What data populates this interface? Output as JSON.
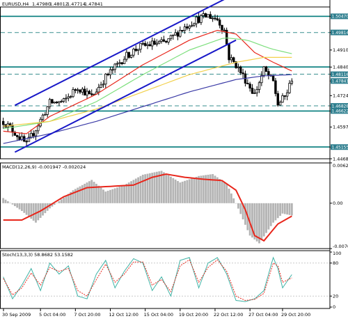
{
  "colors": {
    "background": "#ffffff",
    "grid_line": "#000000",
    "horizontal_level": "#007a7a",
    "dashed_level": "#3a8f8f",
    "trend_channel": "#1818c8",
    "ma_red": "#e8261b",
    "ma_green": "#7ddf7d",
    "ma_yellow": "#f2d04a",
    "ma_blue": "#3a3aa6",
    "macd_histogram": "#b4b4b4",
    "macd_signal": "#e8261b",
    "stoch_main": "#3fb3a6",
    "stoch_signal": "#e8261b",
    "price_tag": "#2f7f8f",
    "candle": "#000000"
  },
  "chart_data": [
    {
      "type": "candlestick",
      "panel": "price",
      "title": "EURUSD,H4",
      "header_values": [
        "1.47980",
        "1.48012",
        "1.47714",
        "1.47841"
      ],
      "ylim": [
        1.4468,
        1.5085
      ],
      "yticks": [
        "1.50470",
        "1.49814",
        "1.49100",
        "1.48407",
        "1.48116",
        "1.47841",
        "1.47245",
        "1.46828",
        "1.46622",
        "1.45970",
        "1.45155",
        "1.44680"
      ],
      "xticks": [
        "30 Sep 2009",
        "5 Oct 04:00",
        "7 Oct 20:00",
        "12 Oct 12:00",
        "15 Oct 04:00",
        "19 Oct 20:00",
        "22 Oct 12:00",
        "27 Oct 04:00",
        "29 Oct 20:00"
      ],
      "candles": {
        "count": 125,
        "start": 1.462,
        "end": 1.4784,
        "path": [
          [
            0,
            1.462
          ],
          [
            6,
            1.4565
          ],
          [
            10,
            1.4525
          ],
          [
            14,
            1.459
          ],
          [
            20,
            1.4695
          ],
          [
            26,
            1.47
          ],
          [
            32,
            1.476
          ],
          [
            38,
            1.472
          ],
          [
            44,
            1.48
          ],
          [
            52,
            1.488
          ],
          [
            58,
            1.492
          ],
          [
            64,
            1.4935
          ],
          [
            70,
            1.494
          ],
          [
            76,
            1.499
          ],
          [
            82,
            1.503
          ],
          [
            88,
            1.505
          ],
          [
            92,
            1.5035
          ],
          [
            95,
            1.499
          ],
          [
            97,
            1.488
          ],
          [
            100,
            1.485
          ],
          [
            104,
            1.479
          ],
          [
            108,
            1.473
          ],
          [
            112,
            1.483
          ],
          [
            116,
            1.478
          ],
          [
            118,
            1.469
          ],
          [
            121,
            1.472
          ],
          [
            124,
            1.4784
          ]
        ]
      },
      "solid_levels": [
        1.5047,
        1.4841,
        1.4662,
        1.4516
      ],
      "dashed_levels": [
        1.4981,
        1.4812,
        1.4683
      ],
      "trend_channel": {
        "lower": [
          [
            5,
            1.4495
          ],
          [
            100,
            1.495
          ]
        ],
        "upper": [
          [
            5,
            1.4685
          ],
          [
            100,
            1.514
          ]
        ]
      },
      "series": [
        {
          "color": "red",
          "values": [
            [
              0,
              1.458
            ],
            [
              10,
              1.457
            ],
            [
              20,
              1.464
            ],
            [
              40,
              1.473
            ],
            [
              60,
              1.485
            ],
            [
              80,
              1.495
            ],
            [
              92,
              1.499
            ],
            [
              100,
              1.4975
            ],
            [
              108,
              1.49
            ],
            [
              116,
              1.486
            ],
            [
              124,
              1.4825
            ]
          ]
        },
        {
          "color": "green",
          "values": [
            [
              0,
              1.459
            ],
            [
              20,
              1.462
            ],
            [
              40,
              1.47
            ],
            [
              60,
              1.481
            ],
            [
              80,
              1.491
            ],
            [
              95,
              1.496
            ],
            [
              105,
              1.495
            ],
            [
              115,
              1.4915
            ],
            [
              124,
              1.4895
            ]
          ]
        },
        {
          "color": "yellow",
          "values": [
            [
              0,
              1.46
            ],
            [
              20,
              1.462
            ],
            [
              40,
              1.467
            ],
            [
              60,
              1.474
            ],
            [
              80,
              1.481
            ],
            [
              100,
              1.486
            ],
            [
              112,
              1.488
            ],
            [
              124,
              1.488
            ]
          ]
        },
        {
          "color": "blue",
          "values": [
            [
              0,
              1.453
            ],
            [
              20,
              1.457
            ],
            [
              40,
              1.462
            ],
            [
              60,
              1.468
            ],
            [
              80,
              1.474
            ],
            [
              100,
              1.479
            ],
            [
              112,
              1.4805
            ],
            [
              124,
              1.481
            ]
          ]
        }
      ]
    },
    {
      "type": "bar",
      "panel": "macd",
      "title": "MACD(12,26,9) -0.001947 -0.002024",
      "ylim": [
        -0.00701,
        0.00622
      ],
      "yticks": [
        "0.006227",
        "0.00",
        "-0.00701"
      ],
      "histogram": [
        [
          0,
          0.0008
        ],
        [
          8,
          -0.0012
        ],
        [
          14,
          -0.003
        ],
        [
          20,
          -0.0008
        ],
        [
          30,
          0.002
        ],
        [
          38,
          0.0036
        ],
        [
          44,
          0.0018
        ],
        [
          52,
          0.0028
        ],
        [
          60,
          0.0044
        ],
        [
          68,
          0.005
        ],
        [
          76,
          0.0032
        ],
        [
          84,
          0.0042
        ],
        [
          90,
          0.0045
        ],
        [
          96,
          0.003
        ],
        [
          100,
          0.0
        ],
        [
          106,
          -0.005
        ],
        [
          110,
          -0.0062
        ],
        [
          116,
          -0.003
        ],
        [
          120,
          -0.0016
        ],
        [
          124,
          -0.0019
        ]
      ],
      "signal": [
        [
          0,
          -0.0026
        ],
        [
          8,
          -0.0026
        ],
        [
          16,
          -0.0012
        ],
        [
          26,
          0.001
        ],
        [
          36,
          0.0024
        ],
        [
          46,
          0.0026
        ],
        [
          56,
          0.0028
        ],
        [
          64,
          0.004
        ],
        [
          70,
          0.0045
        ],
        [
          78,
          0.004
        ],
        [
          86,
          0.0037
        ],
        [
          94,
          0.0035
        ],
        [
          100,
          0.002
        ],
        [
          104,
          -0.001
        ],
        [
          108,
          -0.005
        ],
        [
          112,
          -0.0058
        ],
        [
          118,
          -0.0032
        ],
        [
          124,
          -0.002
        ]
      ]
    },
    {
      "type": "line",
      "panel": "stochastic",
      "title": "Stoch(13,3,3) 58.8682 53.1582",
      "ylim": [
        0,
        100
      ],
      "yticks": [
        "100",
        "80",
        "20",
        "0"
      ],
      "series": [
        {
          "color": "main",
          "values": [
            [
              0,
              55
            ],
            [
              4,
              15
            ],
            [
              8,
              40
            ],
            [
              12,
              70
            ],
            [
              16,
              30
            ],
            [
              20,
              80
            ],
            [
              24,
              60
            ],
            [
              28,
              75
            ],
            [
              32,
              20
            ],
            [
              36,
              15
            ],
            [
              40,
              60
            ],
            [
              44,
              85
            ],
            [
              48,
              35
            ],
            [
              52,
              65
            ],
            [
              56,
              88
            ],
            [
              60,
              80
            ],
            [
              64,
              30
            ],
            [
              68,
              55
            ],
            [
              72,
              20
            ],
            [
              76,
              85
            ],
            [
              80,
              90
            ],
            [
              84,
              35
            ],
            [
              88,
              80
            ],
            [
              92,
              90
            ],
            [
              96,
              60
            ],
            [
              100,
              12
            ],
            [
              104,
              10
            ],
            [
              108,
              15
            ],
            [
              112,
              30
            ],
            [
              116,
              90
            ],
            [
              118,
              70
            ],
            [
              120,
              35
            ],
            [
              124,
              59
            ]
          ]
        },
        {
          "color": "signal",
          "values": [
            [
              0,
              52
            ],
            [
              4,
              22
            ],
            [
              8,
              35
            ],
            [
              12,
              62
            ],
            [
              16,
              40
            ],
            [
              20,
              72
            ],
            [
              24,
              65
            ],
            [
              28,
              70
            ],
            [
              32,
              30
            ],
            [
              36,
              20
            ],
            [
              40,
              50
            ],
            [
              44,
              78
            ],
            [
              48,
              45
            ],
            [
              52,
              60
            ],
            [
              56,
              82
            ],
            [
              60,
              82
            ],
            [
              64,
              40
            ],
            [
              68,
              50
            ],
            [
              72,
              28
            ],
            [
              76,
              75
            ],
            [
              80,
              86
            ],
            [
              84,
              45
            ],
            [
              88,
              72
            ],
            [
              92,
              86
            ],
            [
              96,
              65
            ],
            [
              100,
              20
            ],
            [
              104,
              12
            ],
            [
              108,
              14
            ],
            [
              112,
              25
            ],
            [
              116,
              80
            ],
            [
              118,
              75
            ],
            [
              120,
              45
            ],
            [
              124,
              53
            ]
          ]
        }
      ]
    }
  ]
}
